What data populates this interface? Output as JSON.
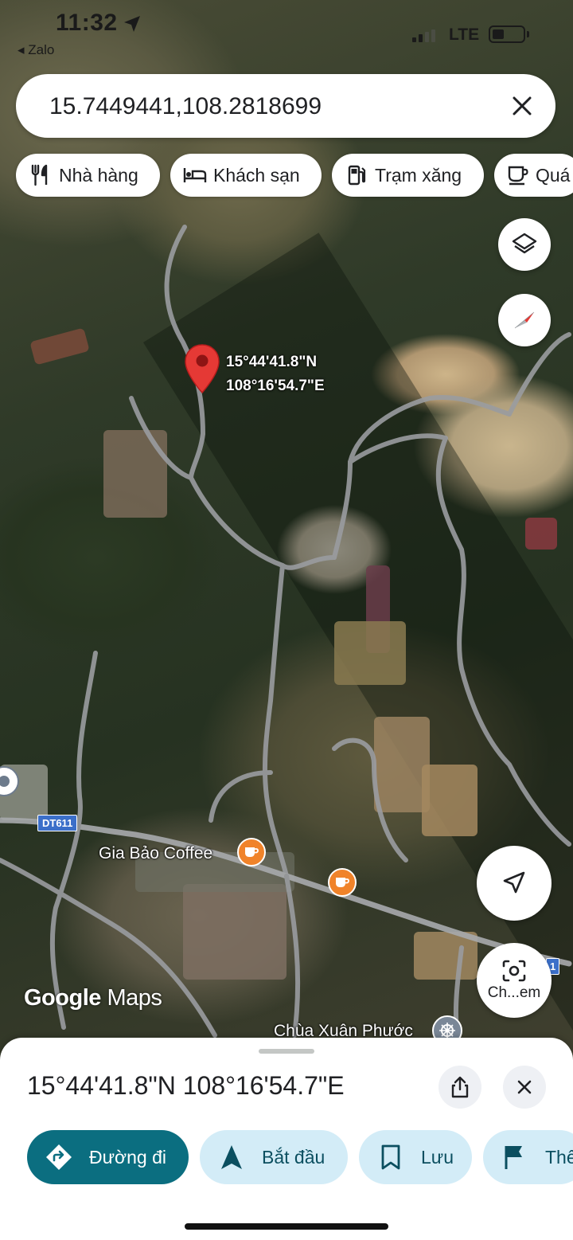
{
  "status_bar": {
    "time": "11:32",
    "back_app": "◂ Zalo",
    "network": "LTE"
  },
  "search": {
    "value": "15.7449441,108.2818699",
    "clear_icon": "close-icon"
  },
  "chips": [
    {
      "label": "Nhà hàng",
      "icon": "restaurant-icon"
    },
    {
      "label": "Khách sạn",
      "icon": "hotel-icon"
    },
    {
      "label": "Trạm xăng",
      "icon": "gas-station-icon"
    },
    {
      "label": "Quá",
      "icon": "coffee-icon"
    }
  ],
  "map": {
    "pin_lat": "15°44'41.8\"N",
    "pin_lng": "108°16'54.7\"E",
    "road_shield": "DT611",
    "road_shield_2": "1",
    "poi_coffee": "Gia Bảo Coffee",
    "poi_temple": "Chùa Xuân Phước",
    "watermark_google": "Google",
    "watermark_maps": "Maps",
    "screenshot_button_label": "Ch...em",
    "accent_pin": "#e53935",
    "poi_color": "#f0832a"
  },
  "sheet": {
    "title": "15°44'41.8\"N 108°16'54.7\"E",
    "actions": [
      {
        "label": "Đường đi",
        "icon": "directions-icon"
      },
      {
        "label": "Bắt đầu",
        "icon": "navigation-icon"
      },
      {
        "label": "Lưu",
        "icon": "bookmark-icon"
      },
      {
        "label": "Thê",
        "icon": "flag-icon"
      }
    ],
    "primary_color": "#0b6e80",
    "secondary_color": "#d3ecf7"
  }
}
